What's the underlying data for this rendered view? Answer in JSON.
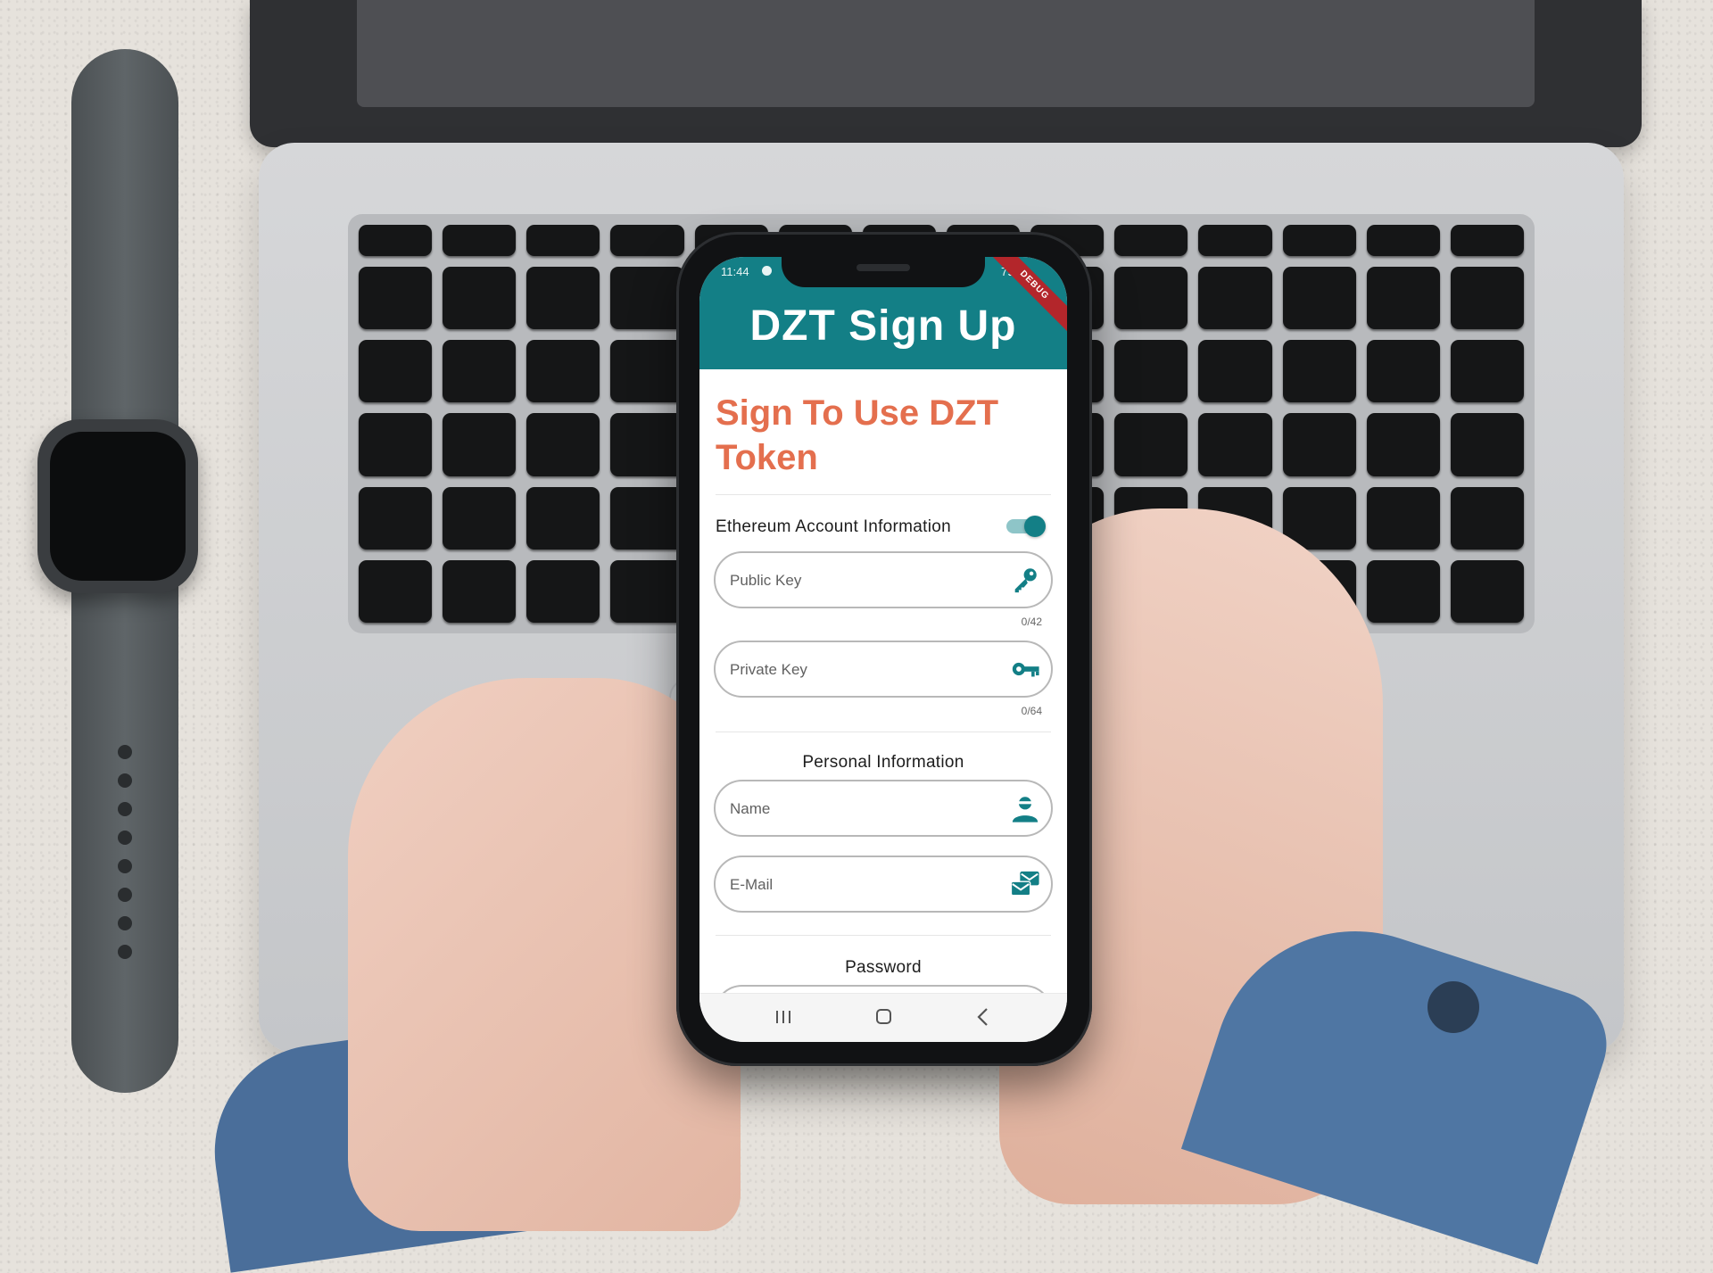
{
  "status_bar": {
    "time": "11:44",
    "battery": "79%"
  },
  "debug_banner": "DEBUG",
  "app_bar": {
    "title": "DZT Sign Up"
  },
  "heading": "Sign To Use DZT Token",
  "ethereum_section": {
    "label": "Ethereum Account Information",
    "toggle_on": true,
    "public_key": {
      "placeholder": "Public Key",
      "counter": "0/42",
      "icon": "key-icon"
    },
    "private_key": {
      "placeholder": "Private Key",
      "counter": "0/64",
      "icon": "vpn-key-icon"
    }
  },
  "personal_section": {
    "label": "Personal Information",
    "name": {
      "placeholder": "Name",
      "icon": "person-icon"
    },
    "email": {
      "placeholder": "E-Mail",
      "icon": "mail-icon"
    }
  },
  "password_section": {
    "label": "Password"
  },
  "nav": [
    "recent-apps-icon",
    "home-icon",
    "back-icon"
  ],
  "colors": {
    "primary": "#137f86",
    "accent": "#e46f4e",
    "toggle_track": "#8ec5c8"
  }
}
